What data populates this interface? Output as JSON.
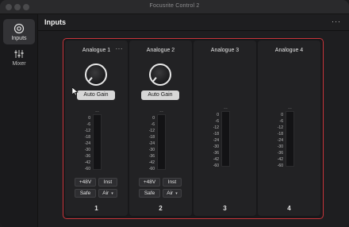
{
  "window": {
    "title": "Focusrite Control 2"
  },
  "sidebar": {
    "items": [
      {
        "label": "Inputs",
        "icon": "inputs-icon",
        "active": true
      },
      {
        "label": "Mixer",
        "icon": "mixer-icon",
        "active": false
      }
    ]
  },
  "main": {
    "title": "Inputs",
    "more": "···"
  },
  "channels": [
    {
      "name": "Analogue 1",
      "more": "···",
      "auto_gain": "Auto Gain",
      "phantom": "+48V",
      "inst": "Inst",
      "safe": "Safe",
      "air": "Air",
      "number": "1"
    },
    {
      "name": "Analogue 2",
      "auto_gain": "Auto Gain",
      "phantom": "+48V",
      "inst": "Inst",
      "safe": "Safe",
      "air": "Air",
      "number": "2"
    },
    {
      "name": "Analogue 3",
      "number": "3"
    },
    {
      "name": "Analogue 4",
      "number": "4"
    }
  ],
  "meter": {
    "clip_label": "~~",
    "scale": [
      "0",
      "-6",
      "-12",
      "-18",
      "-24",
      "-30",
      "-36",
      "-42",
      "-60"
    ]
  },
  "colors": {
    "accent": "#c9353b",
    "background": "#1e1e20",
    "channel_bg": "#222224"
  }
}
